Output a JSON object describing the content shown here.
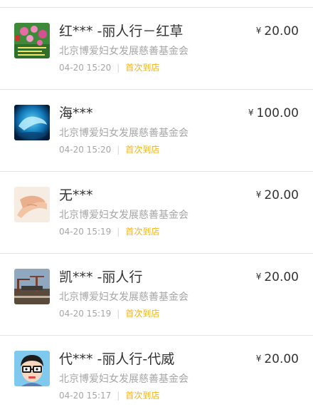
{
  "donations": [
    {
      "name": "红*** -丽人行－红草",
      "organization": "北京博爱妇女发展慈善基金会",
      "time": "04-20 15:20",
      "tag": "首次到店",
      "currency": "¥",
      "amount": "20.00",
      "avatar": "pink-flowers-image"
    },
    {
      "name": "海***",
      "organization": "北京博爱妇女发展慈善基金会",
      "time": "04-20 15:20",
      "tag": "首次到店",
      "currency": "¥",
      "amount": "100.00",
      "avatar": "blue-dolphin-image"
    },
    {
      "name": "无***",
      "organization": "北京博爱妇女发展慈善基金会",
      "time": "04-20 15:19",
      "tag": "首次到店",
      "currency": "¥",
      "amount": "20.00",
      "avatar": "holding-hands-image"
    },
    {
      "name": "凯*** -丽人行",
      "organization": "北京博爱妇女发展慈善基金会",
      "time": "04-20 15:19",
      "tag": "首次到店",
      "currency": "¥",
      "amount": "20.00",
      "avatar": "industrial-port-image"
    },
    {
      "name": "代*** -丽人行-代威",
      "organization": "北京博爱妇女发展慈善基金会",
      "time": "04-20 15:17",
      "tag": "首次到店",
      "currency": "¥",
      "amount": "20.00",
      "avatar": "cartoon-glasses-face-image"
    }
  ]
}
